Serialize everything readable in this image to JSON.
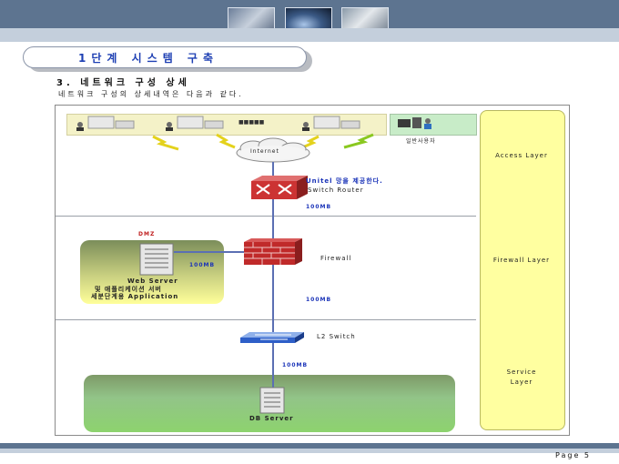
{
  "slide": {
    "title": "1단계 시스템 구축",
    "section": "3. 네트워크 구성 상세",
    "description": "네트워크 구성의 상세내역은 다음과 같다.",
    "page": "Page 5"
  },
  "diagram": {
    "dots": "■■■■■",
    "general_users": "일반사용자",
    "internet": "Internet",
    "router_kr": "Unitel 망을 제공한다.",
    "router_en": "Switch Router",
    "link_router": "100MB",
    "dmz": "DMZ",
    "dmz_link": "100MB",
    "web_server": "Web Server",
    "web_line2": "및 애플리케이션 서버",
    "web_line3": "세분단계용 Application",
    "firewall": "Firewall",
    "link_firewall": "100MB",
    "l2_switch": "L2 Switch",
    "link_db": "100MB",
    "db_server": "DB Server"
  },
  "layers": {
    "access": "Access Layer",
    "firewall": "Firewall Layer",
    "service_line1": "Service",
    "service_line2": "Layer"
  },
  "colors": {
    "band": "#5d7490",
    "band_light": "#c4cfdc",
    "title_text": "#1d3fb3",
    "layer_fill": "#ffffa0",
    "connector": "#5b6fb3"
  }
}
